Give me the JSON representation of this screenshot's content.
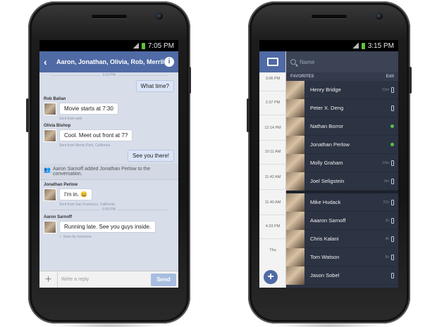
{
  "left_phone": {
    "status_time": "7:05 PM",
    "header": {
      "title": "Aaron, Jonathan, Olivia, Rob, Merrill"
    },
    "timestamps": [
      "3:16 PM",
      "6:56 PM"
    ],
    "outgoing": [
      "What time?",
      "See you there!"
    ],
    "messages": [
      {
        "sender": "Rob Balian",
        "text": "Movie starts at 7:30",
        "meta": "Sent from web"
      },
      {
        "sender": "Olivia Bishop",
        "text": "Cool. Meet out front at 7?",
        "meta": "Sent from Menlo Park, California"
      },
      {
        "sender": "Jonathan Perlow",
        "text": "I'm in. 😀",
        "meta": "Sent from San Francisco, California"
      },
      {
        "sender": "Aaron Sarnoff",
        "text": "Running late. See you guys inside.",
        "meta": "✓ Seen by everyone"
      }
    ],
    "notice": "Aaron Sarnoff added Jonathan Perlow to the conversation.",
    "composer": {
      "placeholder": "Write a reply",
      "send_label": "Send"
    }
  },
  "right_phone": {
    "status_time": "3:15 PM",
    "search_placeholder": "Name",
    "favorites_label": "FAVORITES",
    "edit_label": "Edit",
    "strip_times": [
      "3:06 PM",
      "2:37 PM",
      "12:14 PM",
      "10:11 AM",
      "11:42 AM",
      "11:40 AM",
      "4:33 PM",
      "Thu"
    ],
    "favorites": [
      {
        "name": "Henry Bridge",
        "ago": "53m",
        "status": "mobile"
      },
      {
        "name": "Peter X. Deng",
        "ago": "",
        "status": "mobile"
      },
      {
        "name": "Nathan Borror",
        "ago": "",
        "status": "online"
      },
      {
        "name": "Jonathan Perlow",
        "ago": "",
        "status": "online"
      },
      {
        "name": "Molly Graham",
        "ago": "19m",
        "status": "mobile"
      },
      {
        "name": "Joel Seligstein",
        "ago": "9m",
        "status": "mobile"
      }
    ],
    "others": [
      {
        "name": "Mike Hudack",
        "ago": "21h",
        "status": "mobile"
      },
      {
        "name": "Aaaron Sarnoff",
        "ago": "2h",
        "status": "mobile"
      },
      {
        "name": "Chris Kalani",
        "ago": "4h",
        "status": "mobile"
      },
      {
        "name": "Tom Watson",
        "ago": "5h",
        "status": "mobile"
      },
      {
        "name": "Jason Sobel",
        "ago": "",
        "status": "mobile"
      }
    ]
  }
}
